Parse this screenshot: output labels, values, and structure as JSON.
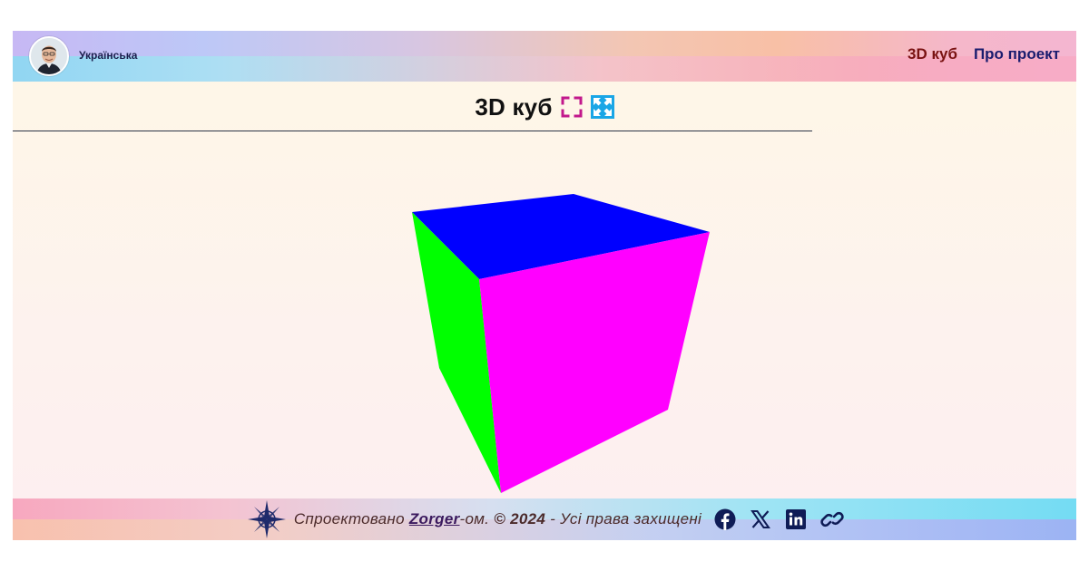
{
  "header": {
    "language_label": "Українська",
    "nav": [
      {
        "label": "3D куб",
        "active": true
      },
      {
        "label": "Про проект",
        "active": false
      }
    ]
  },
  "main": {
    "title": "3D куб",
    "exit_fullscreen_icon": "fullscreen-frame-icon",
    "expand_icon": "expand-arrows-icon"
  },
  "cube": {
    "faces": {
      "top": "#0000ff",
      "front": "#ff00ff",
      "left": "#00ff00"
    }
  },
  "footer": {
    "prefix": "Спроектовано ",
    "author": "Zorger",
    "suffix": "-ом. ",
    "copyright": "© 2024",
    "rights": " - Усі права захищені",
    "socials": [
      "facebook-icon",
      "x-icon",
      "linkedin-icon",
      "link-icon"
    ]
  },
  "colors": {
    "nav_active": "#7a1212",
    "nav_default": "#1a1c6e",
    "accent_magenta": "#c2188c",
    "accent_cyan": "#1aa6e6"
  }
}
